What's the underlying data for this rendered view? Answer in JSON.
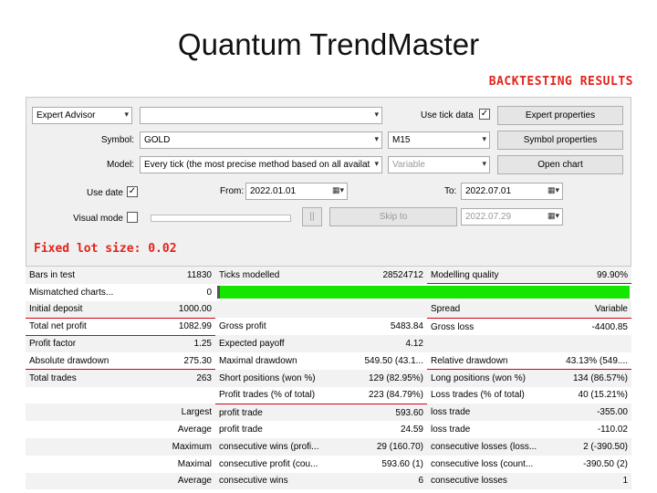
{
  "slide": {
    "title": "Quantum TrendMaster",
    "subtitle": "BACKTESTING RESULTS",
    "note": "Fixed lot size: 0.02"
  },
  "settings": {
    "mode_select": "Expert Advisor",
    "expert_select": "",
    "use_tick_label": "Use tick data",
    "use_tick_checked": "✓",
    "expert_properties": "Expert properties",
    "symbol_label": "Symbol:",
    "symbol_value": "GOLD",
    "period_value": "M15",
    "symbol_properties": "Symbol properties",
    "model_label": "Model:",
    "model_value": "Every tick (the most precise method based on all availat",
    "spread_value": "Variable",
    "open_chart": "Open chart",
    "use_date_label": "Use date",
    "use_date_checked": "✓",
    "from_label": "From:",
    "from_value": "2022.01.01",
    "to_label": "To:",
    "to_value": "2022.07.01",
    "visual_mode_label": "Visual mode",
    "pause_label": "||",
    "skip_to": "Skip to",
    "skip_date": "2022.07.29"
  },
  "results": {
    "rows": [
      {
        "l1": "Bars in test",
        "v1": "11830",
        "l2": "Ticks modelled",
        "v2": "28524712",
        "l3": "Modelling quality",
        "v3": "99.90%"
      },
      {
        "l1": "Mismatched charts...",
        "v1": "0",
        "l2": "",
        "v2": "",
        "l3": "",
        "v3": ""
      },
      {
        "l1": "Initial deposit",
        "v1": "1000.00",
        "l2": "",
        "v2": "",
        "l3": "Spread",
        "v3": "Variable"
      },
      {
        "l1": "Total net profit",
        "v1": "1082.99",
        "l2": "Gross profit",
        "v2": "5483.84",
        "l3": "Gross loss",
        "v3": "-4400.85"
      },
      {
        "l1": "Profit factor",
        "v1": "1.25",
        "l2": "Expected payoff",
        "v2": "4.12",
        "l3": "",
        "v3": ""
      },
      {
        "l1": "Absolute drawdown",
        "v1": "275.30",
        "l2": "Maximal drawdown",
        "v2": "549.50 (43.1...",
        "l3": "Relative drawdown",
        "v3": "43.13% (549...."
      },
      {
        "l1": "Total trades",
        "v1": "263",
        "l2": "Short positions (won %)",
        "v2": "129 (82.95%)",
        "l3": "Long positions (won %)",
        "v3": "134 (86.57%)"
      },
      {
        "l1": "",
        "v1": "",
        "l2": "Profit trades (% of total)",
        "v2": "223 (84.79%)",
        "l3": "Loss trades (% of total)",
        "v3": "40 (15.21%)"
      },
      {
        "l1": "",
        "v1": "Largest",
        "l2": "profit trade",
        "v2": "593.60",
        "l3": "loss trade",
        "v3": "-355.00"
      },
      {
        "l1": "",
        "v1": "Average",
        "l2": "profit trade",
        "v2": "24.59",
        "l3": "loss trade",
        "v3": "-110.02"
      },
      {
        "l1": "",
        "v1": "Maximum",
        "l2": "consecutive wins (profi...",
        "v2": "29 (160.70)",
        "l3": "consecutive losses (loss...",
        "v3": "2 (-390.50)"
      },
      {
        "l1": "",
        "v1": "Maximal",
        "l2": "consecutive profit (cou...",
        "v2": "593.60 (1)",
        "l3": "consecutive loss (count...",
        "v3": "-390.50 (2)"
      },
      {
        "l1": "",
        "v1": "Average",
        "l2": "consecutive wins",
        "v2": "6",
        "l3": "consecutive losses",
        "v3": "1"
      }
    ]
  },
  "colors": {
    "accent_red": "#e2231a",
    "quality_bar": "#13e700"
  }
}
